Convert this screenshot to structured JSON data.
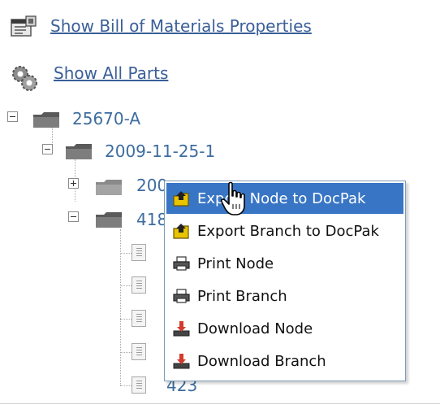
{
  "links": {
    "bom_properties": "Show Bill of Materials Properties",
    "all_parts": "Show All Parts"
  },
  "tree": {
    "root": {
      "label": "25670-A",
      "expanded": true
    },
    "child": {
      "label": "2009-11-25-1",
      "expanded": true
    },
    "grandchild_1": {
      "label": "200",
      "expanded": false
    },
    "grandchild_2": {
      "label": "418",
      "expanded": true
    },
    "leaf_last": {
      "label": "423"
    }
  },
  "context_menu": {
    "items": [
      {
        "label": "Export Node to DocPak",
        "icon": "export-icon",
        "highlighted": true
      },
      {
        "label": "Export Branch to DocPak",
        "icon": "export-icon",
        "highlighted": false
      },
      {
        "label": "Print Node",
        "icon": "printer-icon",
        "highlighted": false
      },
      {
        "label": "Print Branch",
        "icon": "printer-icon",
        "highlighted": false
      },
      {
        "label": "Download Node",
        "icon": "download-icon",
        "highlighted": false
      },
      {
        "label": "Download Branch",
        "icon": "download-icon",
        "highlighted": false
      }
    ]
  },
  "colors": {
    "link": "#3a5f98",
    "tree_text": "#3d6d9f",
    "menu_highlight": "#3875c5",
    "menu_border": "#7f9db9"
  }
}
